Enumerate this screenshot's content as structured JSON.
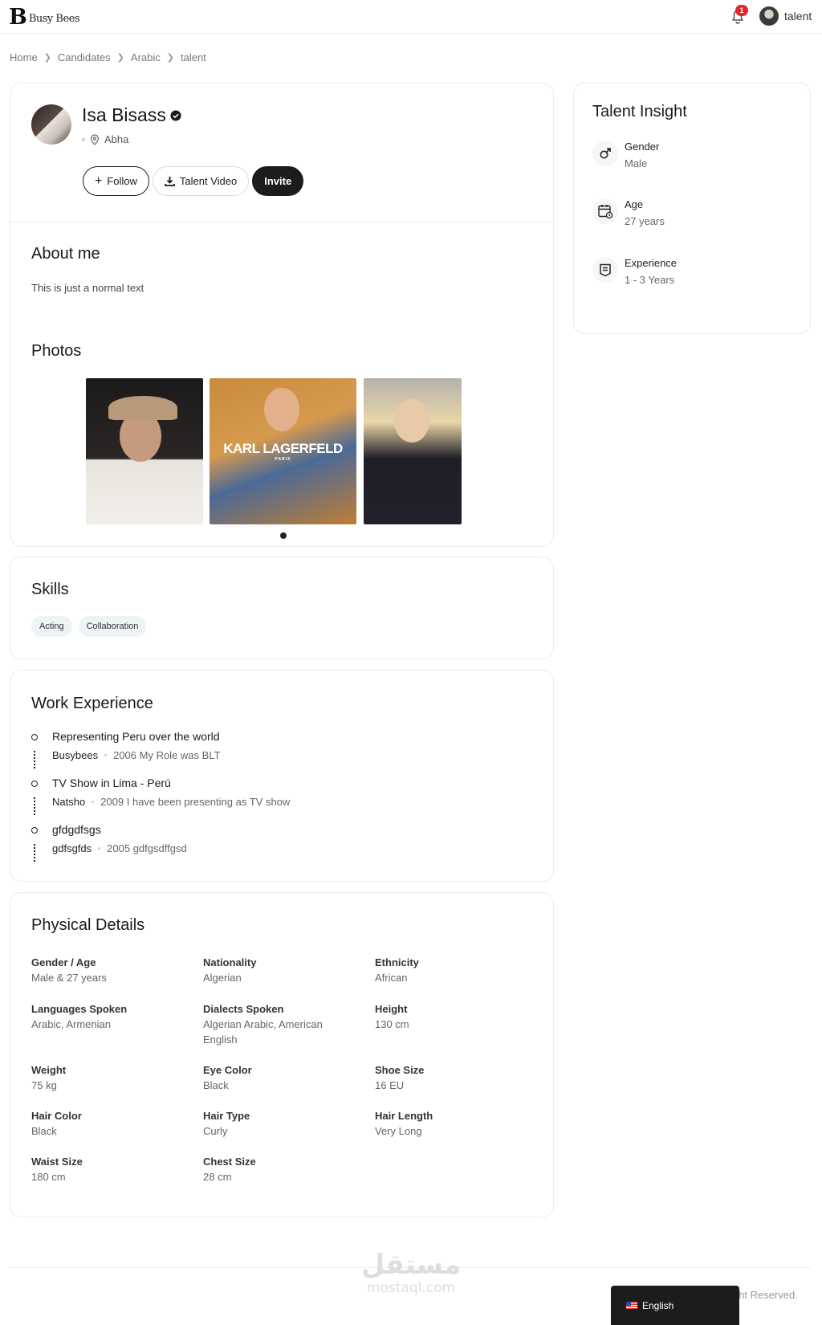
{
  "header": {
    "logo_mark": "B",
    "logo_text": "Busy Bees",
    "notification_count": "1",
    "user_name": "talent"
  },
  "breadcrumb": [
    "Home",
    "Candidates",
    "Arabic",
    "talent"
  ],
  "profile": {
    "name": "Isa Bisass",
    "location": "Abha",
    "buttons": {
      "follow": "Follow",
      "talent_video": "Talent Video",
      "invite": "Invite"
    }
  },
  "about": {
    "title": "About me",
    "text": "This is just a normal text"
  },
  "photos": {
    "title": "Photos",
    "photo2_overlay": "KARL LAGERFELD",
    "photo2_overlay_sub": "PARIS"
  },
  "skills": {
    "title": "Skills",
    "items": [
      "Acting",
      "Collaboration"
    ]
  },
  "work": {
    "title": "Work Experience",
    "items": [
      {
        "role": "Representing Peru over the world",
        "company": "Busybees",
        "details": "2006 My Role was BLT"
      },
      {
        "role": "TV Show in Lima - Perú",
        "company": "Natsho",
        "details": "2009 I have been presenting as TV show"
      },
      {
        "role": "gfdgdfsgs",
        "company": "gdfsgfds",
        "details": "2005 gdfgsdffgsd"
      }
    ]
  },
  "physical": {
    "title": "Physical Details",
    "items": [
      {
        "label": "Gender / Age",
        "value": "Male & 27 years"
      },
      {
        "label": "Nationality",
        "value": "Algerian"
      },
      {
        "label": "Ethnicity",
        "value": "African"
      },
      {
        "label": "Languages Spoken",
        "value": "Arabic, Armenian"
      },
      {
        "label": "Dialects Spoken",
        "value": "Algerian Arabic, American English"
      },
      {
        "label": "Height",
        "value": "130 cm"
      },
      {
        "label": "Weight",
        "value": "75 kg"
      },
      {
        "label": "Eye Color",
        "value": "Black"
      },
      {
        "label": "Shoe Size",
        "value": "16 EU"
      },
      {
        "label": "Hair Color",
        "value": "Black"
      },
      {
        "label": "Hair Type",
        "value": "Curly"
      },
      {
        "label": "Hair Length",
        "value": "Very Long"
      },
      {
        "label": "Waist Size",
        "value": "180 cm"
      },
      {
        "label": "Chest Size",
        "value": "28 cm"
      }
    ]
  },
  "insight": {
    "title": "Talent Insight",
    "items": [
      {
        "label": "Gender",
        "value": "Male",
        "icon": "male-icon"
      },
      {
        "label": "Age",
        "value": "27 years",
        "icon": "calendar-clock-icon"
      },
      {
        "label": "Experience",
        "value": "1 - 3 Years",
        "icon": "badge-icon"
      }
    ]
  },
  "footer": {
    "watermark_ar": "مستقل",
    "watermark_en": "mostaql.com",
    "rights": "ight Reserved.",
    "language": "English"
  },
  "colors": {
    "dark": "#1c1c1c",
    "chip_bg": "#eef3f6",
    "badge_red": "#e0262e"
  }
}
